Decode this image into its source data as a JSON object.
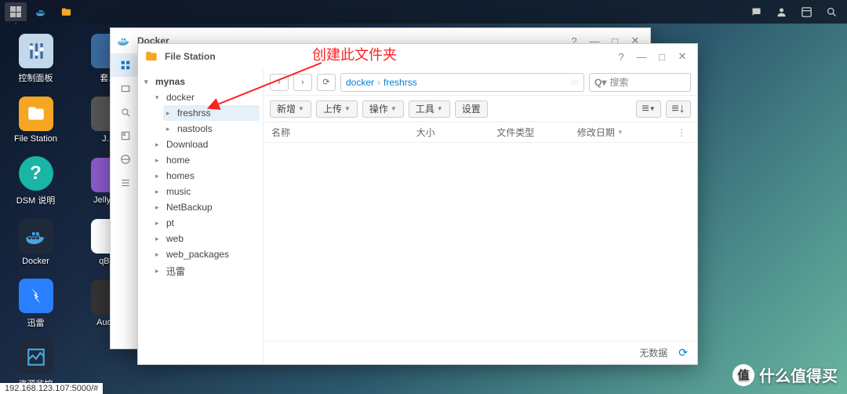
{
  "annotation": "创建此文件夹",
  "taskbar": {
    "ip": "192.168.123.107:5000/#"
  },
  "desktop": {
    "left": [
      {
        "label": "控制面板",
        "ico": "control",
        "bg": "#c3d8ea"
      },
      {
        "label": "File Station",
        "ico": "folder",
        "bg": "#f5a623"
      },
      {
        "label": "DSM 说明",
        "ico": "help",
        "bg": "#19b5a5"
      },
      {
        "label": "Docker",
        "ico": "docker",
        "bg": "#1e2a3a"
      },
      {
        "label": "迅雷",
        "ico": "xunlei",
        "bg": "#2a7fff"
      },
      {
        "label": "资源监控",
        "ico": "monitor",
        "bg": "#1e2a3a"
      }
    ],
    "right": [
      {
        "label": "套..."
      },
      {
        "label": "J..."
      },
      {
        "label": "Jellyfi..."
      },
      {
        "label": "qB..."
      },
      {
        "label": "Aud..."
      }
    ]
  },
  "docker_window": {
    "title": "Docker"
  },
  "fs_window": {
    "title": "File Station",
    "breadcrumb": [
      "docker",
      "freshrss"
    ],
    "search_placeholder": "搜索",
    "actions": {
      "new": "新增",
      "upload": "上传",
      "operate": "操作",
      "tools": "工具",
      "settings": "设置"
    },
    "columns": {
      "name": "名称",
      "size": "大小",
      "type": "文件类型",
      "date": "修改日期"
    },
    "empty": "无数据",
    "tree": {
      "root": "mynas",
      "docker": "docker",
      "docker_children": [
        "freshrss",
        "nastools"
      ],
      "others": [
        "Download",
        "home",
        "homes",
        "music",
        "NetBackup",
        "pt",
        "web",
        "web_packages",
        "迅雷"
      ]
    }
  },
  "watermark": "什么值得买"
}
